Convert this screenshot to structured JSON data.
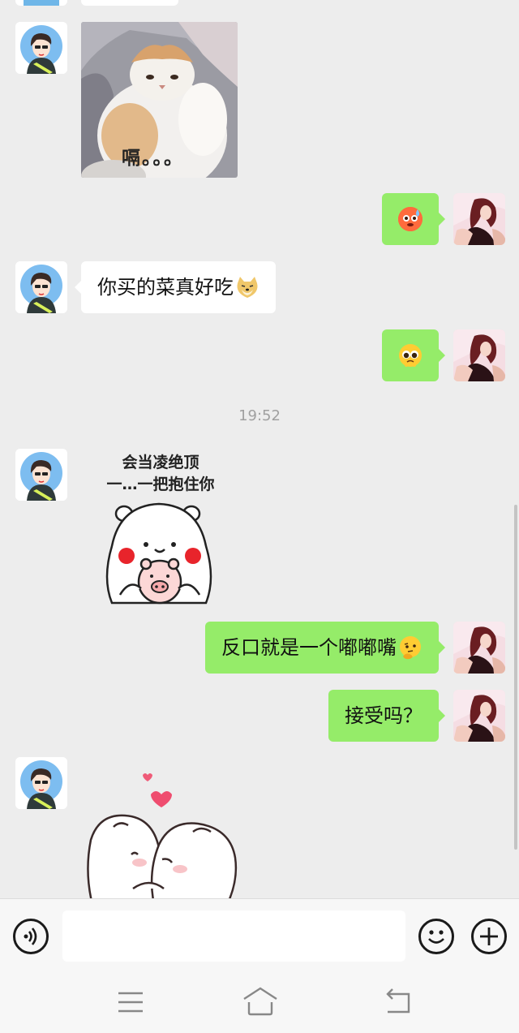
{
  "messages": {
    "cat_caption": "嗝。。。",
    "text_1": "你买的菜真好吃",
    "timestamp": "19:52",
    "sticker_line1": "会当凌绝顶",
    "sticker_line2": "一…一把抱住你",
    "text_2": "反口就是一个嘟嘟嘴",
    "text_3": "接受吗？"
  },
  "emojis": {
    "out_1": "sweat-face",
    "text_1_suffix": "doge",
    "out_2": "pleading-face",
    "text_2_suffix": "thinking-face"
  },
  "colors": {
    "background": "#ededed",
    "outgoing_bubble": "#95ec69",
    "incoming_bubble": "#ffffff",
    "timestamp": "#a0a0a0"
  },
  "input": {
    "placeholder": ""
  }
}
